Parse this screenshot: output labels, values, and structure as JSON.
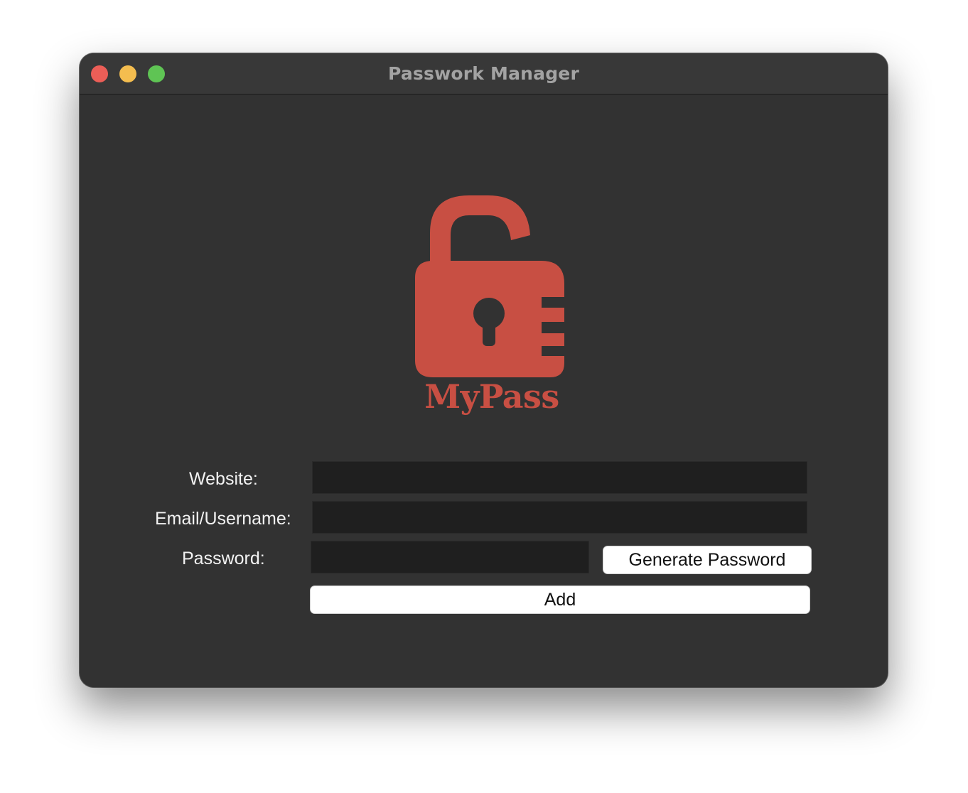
{
  "window": {
    "title": "Passwork Manager"
  },
  "logo": {
    "icon": "unlocked-padlock-icon",
    "text": "MyPass",
    "color": "#c84f43"
  },
  "form": {
    "website_label": "Website:",
    "website_value": "",
    "email_label": "Email/Username:",
    "email_value": "",
    "password_label": "Password:",
    "password_value": "",
    "generate_button": "Generate Password",
    "add_button": "Add"
  },
  "colors": {
    "window_bg": "#323232",
    "entry_bg": "#1f1f1f",
    "button_bg": "#ffffff"
  }
}
